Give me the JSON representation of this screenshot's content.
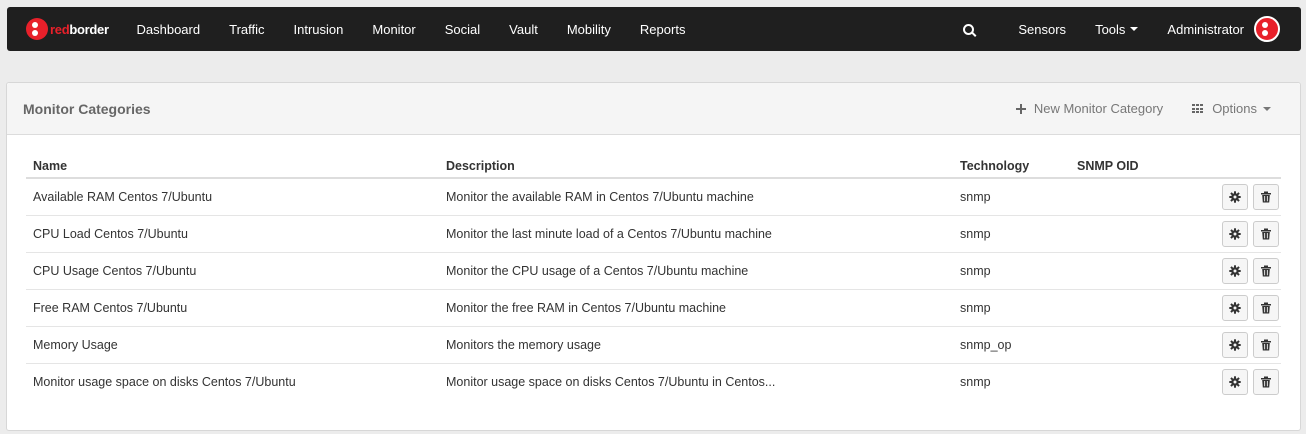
{
  "brand": {
    "part1": "red",
    "part2": "border"
  },
  "nav": {
    "items": [
      "Dashboard",
      "Traffic",
      "Intrusion",
      "Monitor",
      "Social",
      "Vault",
      "Mobility",
      "Reports"
    ],
    "sensors": "Sensors",
    "tools": "Tools",
    "user": "Administrator"
  },
  "panel": {
    "title": "Monitor Categories",
    "new_label": "New Monitor Category",
    "options_label": "Options"
  },
  "table": {
    "headers": {
      "name": "Name",
      "description": "Description",
      "technology": "Technology",
      "oid": "SNMP OID"
    },
    "rows": [
      {
        "name": "Available RAM Centos 7/Ubuntu",
        "description": "Monitor the available RAM in Centos 7/Ubuntu machine",
        "technology": "snmp",
        "oid": ""
      },
      {
        "name": "CPU Load Centos 7/Ubuntu",
        "description": "Monitor the last minute load of a Centos 7/Ubuntu machine",
        "technology": "snmp",
        "oid": ""
      },
      {
        "name": "CPU Usage Centos 7/Ubuntu",
        "description": "Monitor the CPU usage of a Centos 7/Ubuntu machine",
        "technology": "snmp",
        "oid": ""
      },
      {
        "name": "Free RAM Centos 7/Ubuntu",
        "description": "Monitor the free RAM in Centos 7/Ubuntu machine",
        "technology": "snmp",
        "oid": ""
      },
      {
        "name": "Memory Usage",
        "description": "Monitors the memory usage",
        "technology": "snmp_op",
        "oid": ""
      },
      {
        "name": "Monitor usage space on disks Centos 7/Ubuntu",
        "description": "Monitor usage space on disks Centos 7/Ubuntu in Centos...",
        "technology": "snmp",
        "oid": ""
      }
    ]
  },
  "icons": {
    "brand_logo": "redborder-logo-icon",
    "search": "search-icon",
    "user_avatar": "redborder-avatar-icon",
    "new": "plus-icon",
    "options": "grid-icon",
    "edit": "gear-icon",
    "delete": "trash-icon"
  },
  "colors": {
    "navbar": "#1f1f1f",
    "brand_red": "#e8202a",
    "panel_header": "#f5f5f5"
  }
}
